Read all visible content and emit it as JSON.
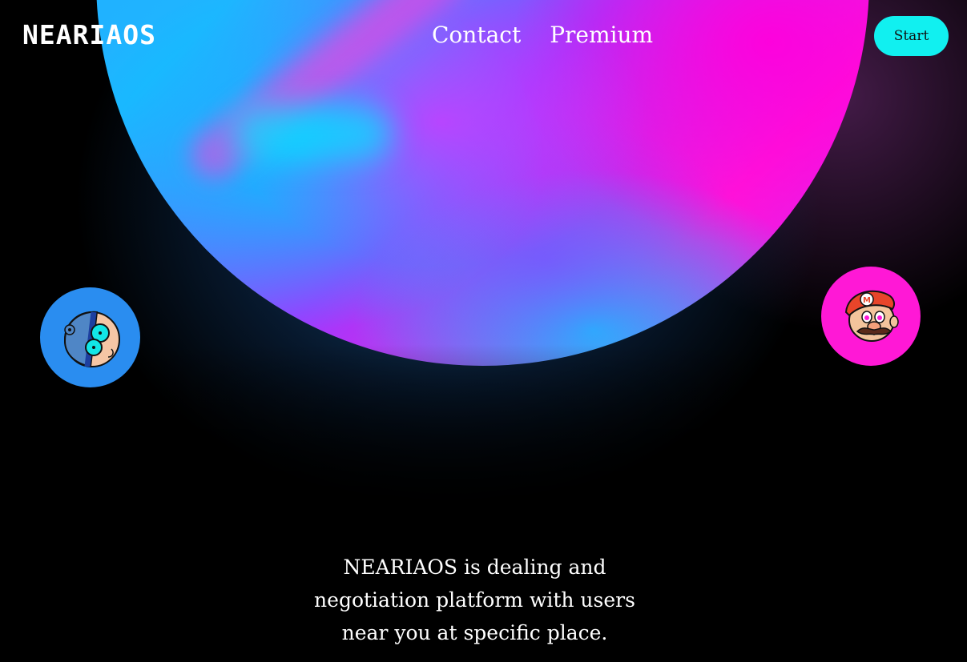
{
  "header": {
    "logo": "NEARIAOS",
    "nav": [
      {
        "label": "Contact"
      },
      {
        "label": "Premium"
      }
    ],
    "start_button": "Start"
  },
  "hero": {
    "left_avatar_icon": "beanie-kid-avatar-icon",
    "right_avatar_icon": "mustache-plumber-avatar-icon"
  },
  "description": {
    "text": "NEARIAOS is dealing and negotiation platform with users near you at specific place."
  },
  "colors": {
    "background": "#000000",
    "accent_cyan": "#11f0f0",
    "avatar_blue": "#2a8df0",
    "avatar_pink": "#ff18d6"
  }
}
